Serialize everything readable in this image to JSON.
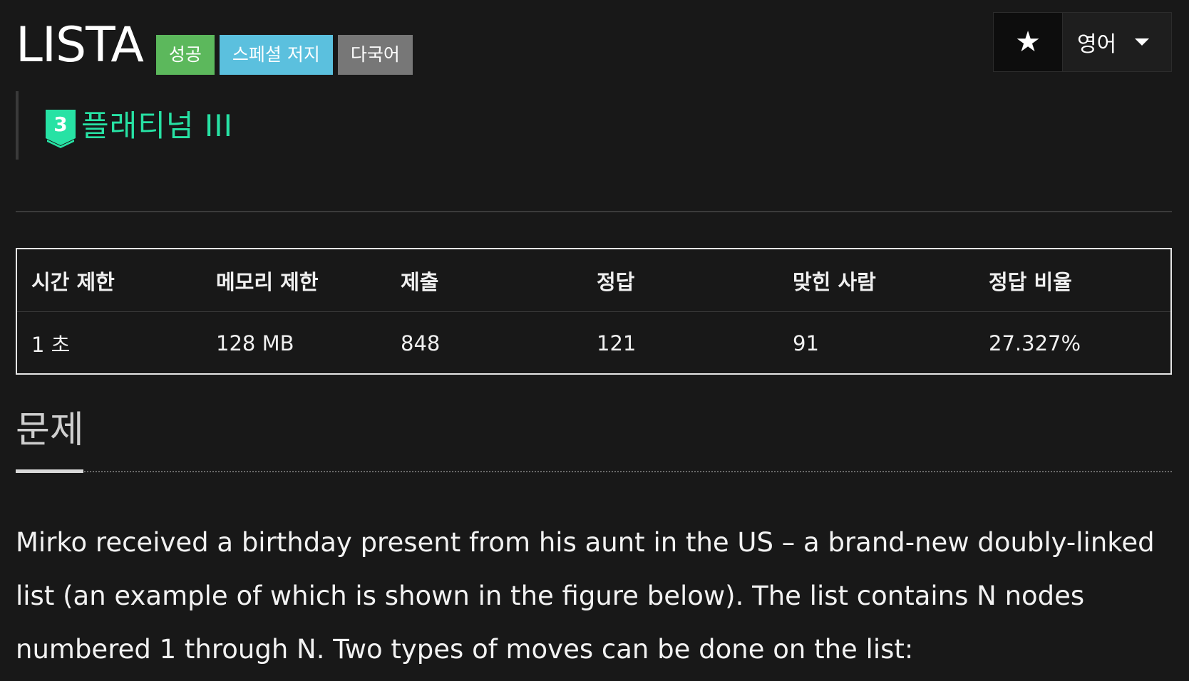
{
  "header": {
    "title": "LISTA",
    "badges": {
      "success": "성공",
      "special": "스페셜 저지",
      "multilang": "다국어"
    },
    "star_icon": "★",
    "language_label": "영어"
  },
  "tier": {
    "icon_number": "3",
    "label": "플래티넘 III",
    "color": "#27e2a4"
  },
  "info_table": {
    "headers": [
      "시간 제한",
      "메모리 제한",
      "제출",
      "정답",
      "맞힌 사람",
      "정답 비율"
    ],
    "values": [
      "1 초",
      "128 MB",
      "848",
      "121",
      "91",
      "27.327%"
    ]
  },
  "section": {
    "title": "문제",
    "text": "Mirko received a birthday present from his aunt in the US – a brand-new doubly-linked list (an example of which is shown in the figure below). The list contains N nodes numbered 1 through N. Two types of moves can be done on the list:"
  },
  "colors": {
    "background": "#181818",
    "badge_success": "#5cb85c",
    "badge_special": "#5bc0de",
    "badge_multilang": "#777777",
    "tier": "#27e2a4"
  }
}
